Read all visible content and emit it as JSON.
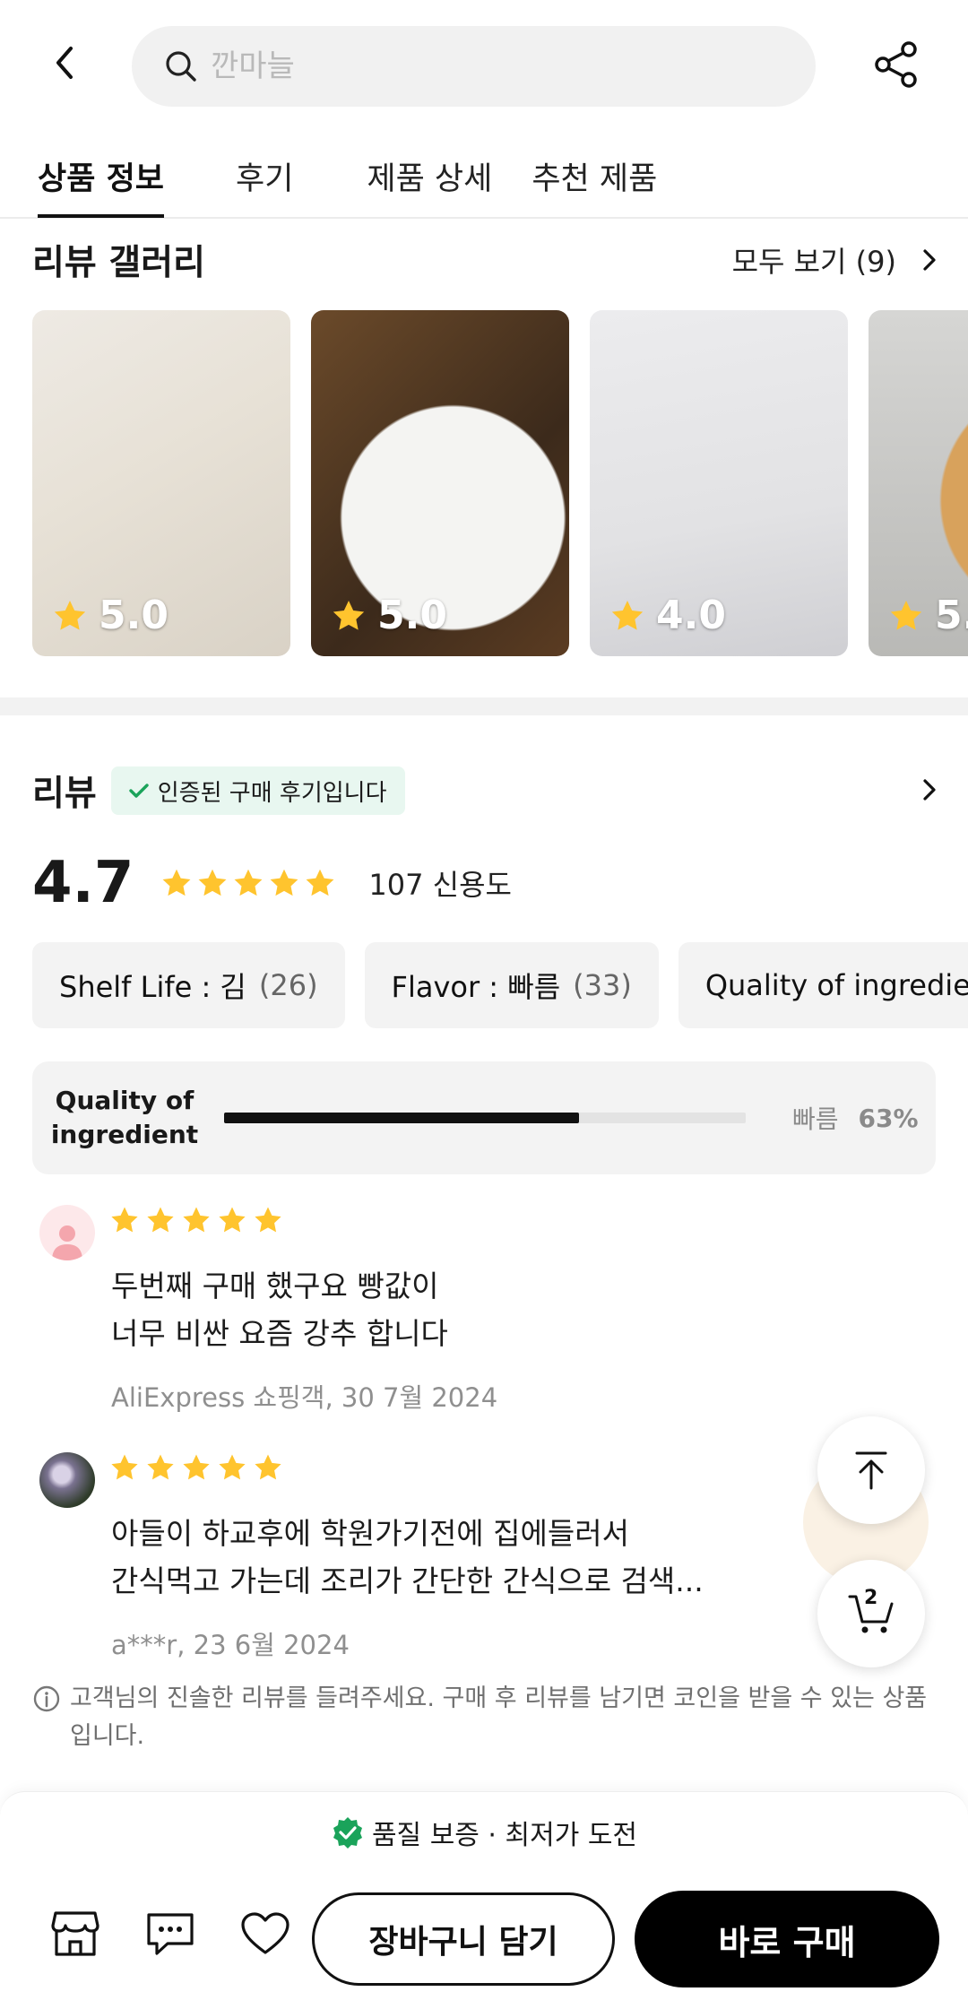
{
  "search": {
    "placeholder": "깐마늘"
  },
  "tabs": [
    {
      "label": "상품 정보",
      "active": true
    },
    {
      "label": "후기",
      "active": false
    },
    {
      "label": "제품 상세",
      "active": false
    },
    {
      "label": "추천 제품",
      "active": false
    }
  ],
  "gallery": {
    "title": "리뷰 갤러리",
    "view_all": "모두 보기 (9)",
    "photos": [
      {
        "rating": "5.0"
      },
      {
        "rating": "5.0"
      },
      {
        "rating": "4.0"
      },
      {
        "rating": "5."
      }
    ]
  },
  "reviews": {
    "title": "리뷰",
    "verified_label": "인증된 구매 후기입니다",
    "score": "4.7",
    "score_stars": 5,
    "score_count": "107 신용도",
    "chips": [
      {
        "label": "Shelf Life : 김",
        "count": "(26)"
      },
      {
        "label": "Flavor : 빠름",
        "count": "(33)"
      },
      {
        "label": "Quality of ingredient",
        "count": ""
      }
    ],
    "quality": {
      "label": "Quality of ingredient",
      "word": "빠름",
      "percent_text": "63%",
      "fraction": 0.68
    },
    "items": [
      {
        "stars": 5,
        "text": "두번째 구매 했구요 빵값이\n너무 비싼 요즘 강추 합니다",
        "meta": "AliExpress 쇼핑객, 30 7월 2024"
      },
      {
        "stars": 5,
        "text": "아들이 하교후에 학원가기전에 집에들러서\n간식먹고 가는데  조리가 간단한 간식으로 검색...",
        "meta": "a***r, 23 6월 2024"
      }
    ],
    "note": "고객님의 진솔한 리뷰를 들려주세요. 구매 후 리뷰를 남기면 코인을 받을 수 있는 상품입니다."
  },
  "floating": {
    "cart_count": "2"
  },
  "bottom_bar": {
    "guarantee": "품질 보증 · 최저가 도전",
    "add_to_cart": "장바구니 담기",
    "buy_now": "바로 구매"
  },
  "colors": {
    "star": "#FFC42E",
    "verified_bg": "#E8F7F0",
    "verified_check": "#1AA35A",
    "buy_button": "#000000"
  }
}
